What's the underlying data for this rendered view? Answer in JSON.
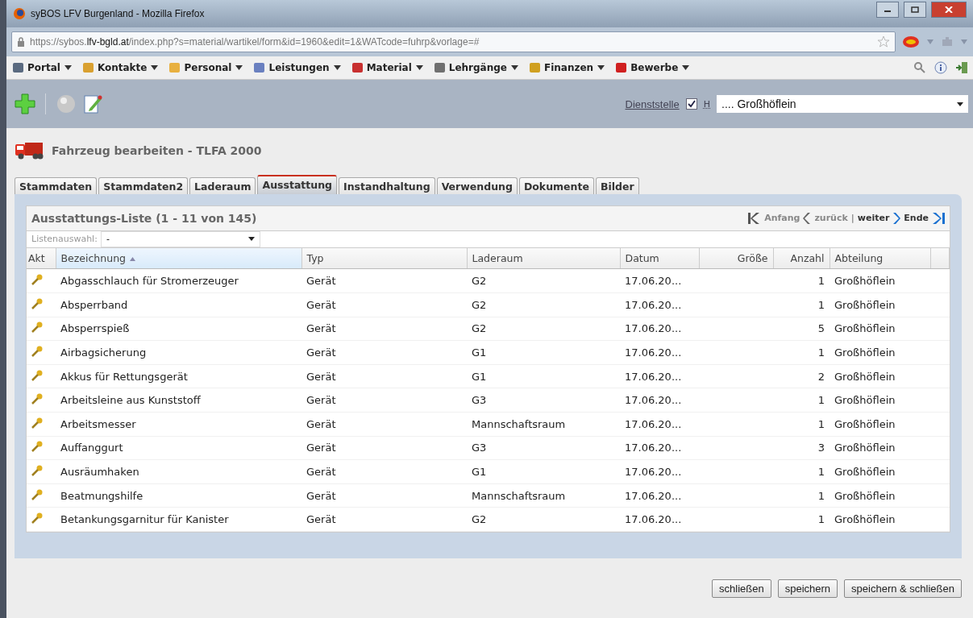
{
  "window": {
    "title": "syBOS LFV Burgenland - Mozilla Firefox"
  },
  "address_bar": {
    "url_prefix": "https://sybos.",
    "url_domain": "lfv-bgld.at",
    "url_rest": "/index.php?s=material/wartikel/form&id=1960&edit=1&WATcode=fuhrp&vorlage=#"
  },
  "menu": [
    {
      "label": "Portal",
      "color": "#5a6a80"
    },
    {
      "label": "Kontakte",
      "color": "#d9a030"
    },
    {
      "label": "Personal",
      "color": "#e8b040"
    },
    {
      "label": "Leistungen",
      "color": "#6a80c0"
    },
    {
      "label": "Material",
      "color": "#c83030"
    },
    {
      "label": "Lehrgänge",
      "color": "#707070"
    },
    {
      "label": "Finanzen",
      "color": "#d0a020"
    },
    {
      "label": "Bewerbe",
      "color": "#d02020"
    }
  ],
  "toolbar": {
    "dienststelle_link": "Dienststelle",
    "dienststelle_checked": true,
    "h_label": "H",
    "dienststelle_value": ".... Großhöflein"
  },
  "page_title": "Fahrzeug bearbeiten - TLFA 2000",
  "tabs": [
    {
      "label": "Stammdaten",
      "selected": false
    },
    {
      "label": "Stammdaten2",
      "selected": false
    },
    {
      "label": "Laderaum",
      "selected": false
    },
    {
      "label": "Ausstattung",
      "selected": true
    },
    {
      "label": "Instandhaltung",
      "selected": false
    },
    {
      "label": "Verwendung",
      "selected": false
    },
    {
      "label": "Dokumente",
      "selected": false
    },
    {
      "label": "Bilder",
      "selected": false
    }
  ],
  "list": {
    "title": "Ausstattungs-Liste (1 - 11 von 145)",
    "pager": {
      "first": "Anfang",
      "prev": "zurück",
      "separator": "|",
      "next": "weiter",
      "last": "Ende"
    },
    "filter_label": "Listenauswahl:",
    "filter_value": "-"
  },
  "table": {
    "columns": [
      "Akt",
      "Bezeichnung",
      "Typ",
      "Laderaum",
      "Datum",
      "Größe",
      "Anzahl",
      "Abteilung"
    ],
    "rows": [
      {
        "name": "Abgasschlauch für Stromerzeuger",
        "typ": "Gerät",
        "laderaum": "G2",
        "datum": "17.06.20...",
        "anzahl": "1",
        "abteilung": "Großhöflein"
      },
      {
        "name": "Absperrband",
        "typ": "Gerät",
        "laderaum": "G2",
        "datum": "17.06.20...",
        "anzahl": "1",
        "abteilung": "Großhöflein"
      },
      {
        "name": "Absperrspieß",
        "typ": "Gerät",
        "laderaum": "G2",
        "datum": "17.06.20...",
        "anzahl": "5",
        "abteilung": "Großhöflein"
      },
      {
        "name": "Airbagsicherung",
        "typ": "Gerät",
        "laderaum": "G1",
        "datum": "17.06.20...",
        "anzahl": "1",
        "abteilung": "Großhöflein"
      },
      {
        "name": "Akkus für Rettungsgerät",
        "typ": "Gerät",
        "laderaum": "G1",
        "datum": "17.06.20...",
        "anzahl": "2",
        "abteilung": "Großhöflein"
      },
      {
        "name": "Arbeitsleine aus Kunststoff",
        "typ": "Gerät",
        "laderaum": "G3",
        "datum": "17.06.20...",
        "anzahl": "1",
        "abteilung": "Großhöflein"
      },
      {
        "name": "Arbeitsmesser",
        "typ": "Gerät",
        "laderaum": "Mannschaftsraum",
        "datum": "17.06.20...",
        "anzahl": "1",
        "abteilung": "Großhöflein"
      },
      {
        "name": "Auffanggurt",
        "typ": "Gerät",
        "laderaum": "G3",
        "datum": "17.06.20...",
        "anzahl": "3",
        "abteilung": "Großhöflein"
      },
      {
        "name": "Ausräumhaken",
        "typ": "Gerät",
        "laderaum": "G1",
        "datum": "17.06.20...",
        "anzahl": "1",
        "abteilung": "Großhöflein"
      },
      {
        "name": "Beatmungshilfe",
        "typ": "Gerät",
        "laderaum": "Mannschaftsraum",
        "datum": "17.06.20...",
        "anzahl": "1",
        "abteilung": "Großhöflein"
      },
      {
        "name": "Betankungsgarnitur für Kanister",
        "typ": "Gerät",
        "laderaum": "G2",
        "datum": "17.06.20...",
        "anzahl": "1",
        "abteilung": "Großhöflein"
      }
    ]
  },
  "buttons": [
    "schließen",
    "speichern",
    "speichern & schließen"
  ]
}
